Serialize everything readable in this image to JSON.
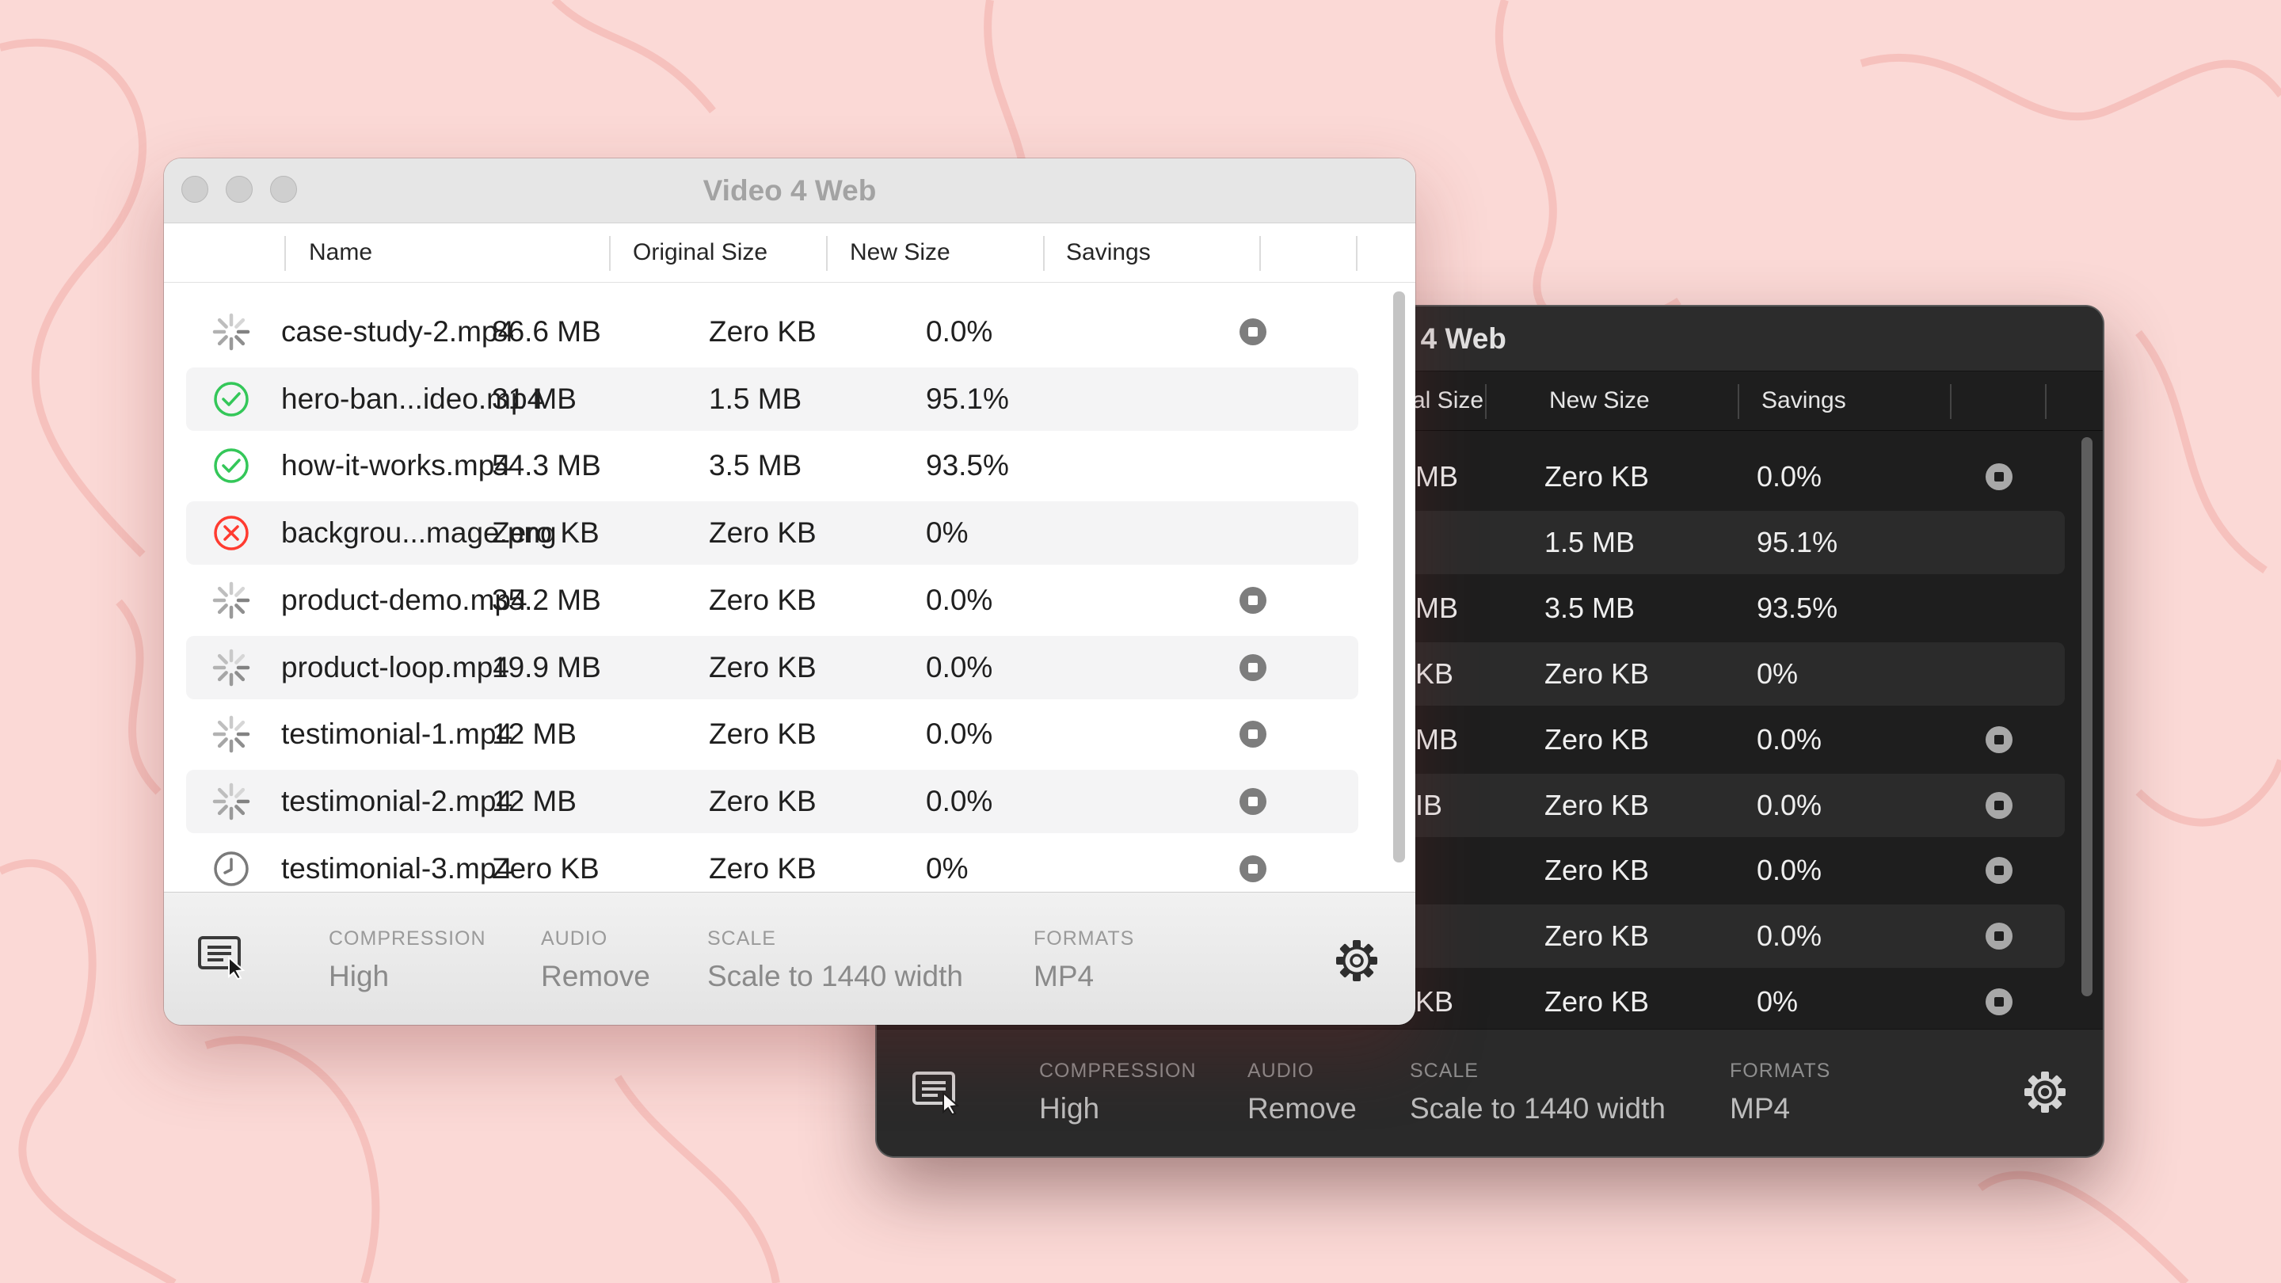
{
  "colors": {
    "background": "#fbd9d6",
    "background_lines": "#f2aaa6",
    "success_green": "#34c759",
    "error_red": "#ff3b30",
    "light_row_stripe": "#f4f4f5",
    "dark_row_stripe": "#2b2b2b"
  },
  "icons": {
    "in_progress": "spinner-icon",
    "done": "checkmark-circle-icon",
    "failed": "x-circle-icon",
    "queued": "clock-icon",
    "cancel": "stop-icon",
    "queue_list": "list-cursor-icon",
    "settings": "gear-icon"
  },
  "light_window": {
    "title": "Video 4 Web",
    "columns": {
      "name": "Name",
      "original_size": "Original Size",
      "new_size": "New Size",
      "savings": "Savings"
    },
    "rows": [
      {
        "status": "in-progress",
        "name": "case-study-2.mp4",
        "original": "86.6 MB",
        "new": "Zero KB",
        "savings": "0.0%",
        "cancelable": true
      },
      {
        "status": "done",
        "name": "hero-ban...ideo.mp4",
        "original": "31 MB",
        "new": "1.5 MB",
        "savings": "95.1%",
        "cancelable": false
      },
      {
        "status": "done",
        "name": "how-it-works.mp4",
        "original": "54.3 MB",
        "new": "3.5 MB",
        "savings": "93.5%",
        "cancelable": false
      },
      {
        "status": "failed",
        "name": "backgrou...mage.png",
        "original": "Zero KB",
        "new": "Zero KB",
        "savings": "0%",
        "cancelable": false
      },
      {
        "status": "in-progress",
        "name": "product-demo.mp4",
        "original": "35.2 MB",
        "new": "Zero KB",
        "savings": "0.0%",
        "cancelable": true
      },
      {
        "status": "in-progress",
        "name": "product-loop.mp4",
        "original": "19.9 MB",
        "new": "Zero KB",
        "savings": "0.0%",
        "cancelable": true
      },
      {
        "status": "in-progress",
        "name": "testimonial-1.mp4",
        "original": "12 MB",
        "new": "Zero KB",
        "savings": "0.0%",
        "cancelable": true
      },
      {
        "status": "in-progress",
        "name": "testimonial-2.mp4",
        "original": "12 MB",
        "new": "Zero KB",
        "savings": "0.0%",
        "cancelable": true
      },
      {
        "status": "queued",
        "name": "testimonial-3.mp4",
        "original": "Zero KB",
        "new": "Zero KB",
        "savings": "0%",
        "cancelable": true
      }
    ],
    "footer": {
      "compression_label": "COMPRESSION",
      "compression_value": "High",
      "audio_label": "AUDIO",
      "audio_value": "Remove",
      "scale_label": "SCALE",
      "scale_value": "Scale to 1440 width",
      "formats_label": "FORMATS",
      "formats_value": "MP4"
    }
  },
  "dark_window": {
    "title": "/ideo 4 Web",
    "columns": {
      "original_size": "al Size",
      "new_size": "New Size",
      "savings": "Savings"
    },
    "rows": [
      {
        "original": "MB",
        "new": "Zero KB",
        "savings": "0.0%",
        "cancelable": true
      },
      {
        "original": "",
        "new": "1.5 MB",
        "savings": "95.1%",
        "cancelable": false
      },
      {
        "original": "MB",
        "new": "3.5 MB",
        "savings": "93.5%",
        "cancelable": false
      },
      {
        "original": "KB",
        "new": "Zero KB",
        "savings": "0%",
        "cancelable": false
      },
      {
        "original": "MB",
        "new": "Zero KB",
        "savings": "0.0%",
        "cancelable": true
      },
      {
        "original": "IB",
        "new": "Zero KB",
        "savings": "0.0%",
        "cancelable": true
      },
      {
        "original": "",
        "new": "Zero KB",
        "savings": "0.0%",
        "cancelable": true
      },
      {
        "original": "",
        "new": "Zero KB",
        "savings": "0.0%",
        "cancelable": true
      },
      {
        "original": "KB",
        "new": "Zero KB",
        "savings": "0%",
        "cancelable": true
      }
    ],
    "footer": {
      "compression_label": "COMPRESSION",
      "compression_value": "High",
      "audio_label": "AUDIO",
      "audio_value": "Remove",
      "scale_label": "SCALE",
      "scale_value": "Scale to 1440 width",
      "formats_label": "FORMATS",
      "formats_value": "MP4"
    }
  }
}
